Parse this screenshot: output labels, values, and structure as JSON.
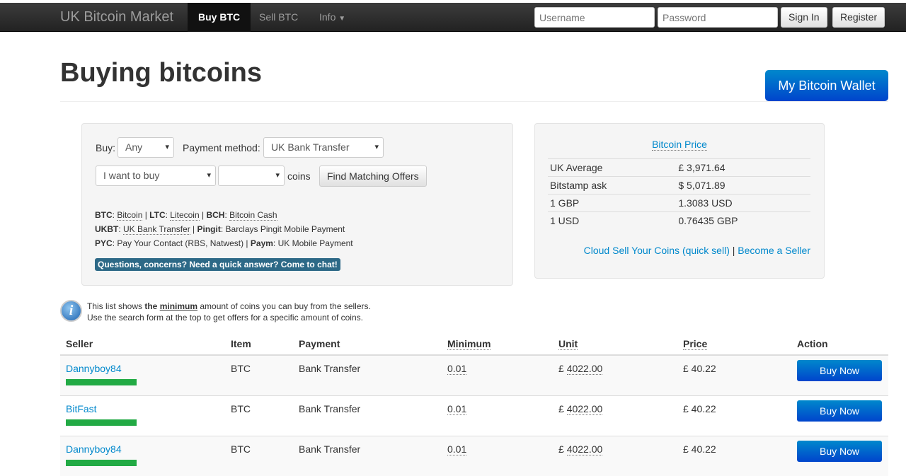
{
  "nav": {
    "brand": "UK Bitcoin Market",
    "links": [
      "Buy BTC",
      "Sell BTC",
      "Info"
    ],
    "username_placeholder": "Username",
    "password_placeholder": "Password",
    "signin": "Sign In",
    "register": "Register"
  },
  "page": {
    "title": "Buying bitcoins",
    "wallet": "My Bitcoin Wallet"
  },
  "search": {
    "buy_label": "Buy:",
    "buy_value": "Any",
    "payment_label": "Payment method:",
    "payment_value": "UK Bank Transfer",
    "mode_value": "I want to buy",
    "amount_value": "",
    "coins": "coins",
    "find": "Find Matching Offers",
    "legend": [
      [
        "BTC",
        ": ",
        "Bitcoin",
        " | ",
        "LTC",
        ": ",
        "Litecoin",
        " | ",
        "BCH",
        ": ",
        "Bitcoin Cash"
      ],
      [
        "UKBT",
        ": ",
        "UK Bank Transfer",
        " | ",
        "Pingit",
        ": Barclays Pingit Mobile Payment"
      ],
      [
        "PYC",
        ": Pay Your Contact (RBS, Natwest) | ",
        "Paym",
        ": UK Mobile Payment"
      ]
    ],
    "chat": "Questions, concerns? Need a quick answer? Come to chat!"
  },
  "price": {
    "title": "Bitcoin Price",
    "rows": [
      [
        "UK Average",
        "£ 3,971.64"
      ],
      [
        "Bitstamp ask",
        "$ 5,071.89"
      ],
      [
        "1 GBP",
        "1.3083 USD"
      ],
      [
        "1 USD",
        "0.76435 GBP"
      ]
    ],
    "cloud_sell": "Cloud Sell Your Coins (quick sell)",
    "sep": "|",
    "become": "Become a Seller"
  },
  "info": {
    "a": "This list shows ",
    "b": "the ",
    "c": "minimum",
    "d": " amount of coins you can buy from the sellers.",
    "e": "Use the search form at the top to get offers for a specific amount of coins."
  },
  "offers": {
    "headers": [
      "Seller",
      "Item",
      "Payment",
      "Minimum",
      "Unit",
      "Price",
      "Action"
    ],
    "rows": [
      {
        "seller": "Dannyboy84",
        "item": "BTC",
        "payment": "Bank Transfer",
        "min": "0.01",
        "unit": "4022.00",
        "price": "£ 40.22",
        "action": "Buy Now",
        "rating": 1
      },
      {
        "seller": "BitFast",
        "item": "BTC",
        "payment": "Bank Transfer",
        "min": "0.01",
        "unit": "4022.00",
        "price": "£ 40.22",
        "action": "Buy Now",
        "rating": 1
      },
      {
        "seller": "Dannyboy84",
        "item": "BTC",
        "payment": "Bank Transfer",
        "min": "0.01",
        "unit": "4022.00",
        "price": "£ 40.22",
        "action": "Buy Now",
        "rating": 1
      }
    ],
    "currency": "£"
  }
}
